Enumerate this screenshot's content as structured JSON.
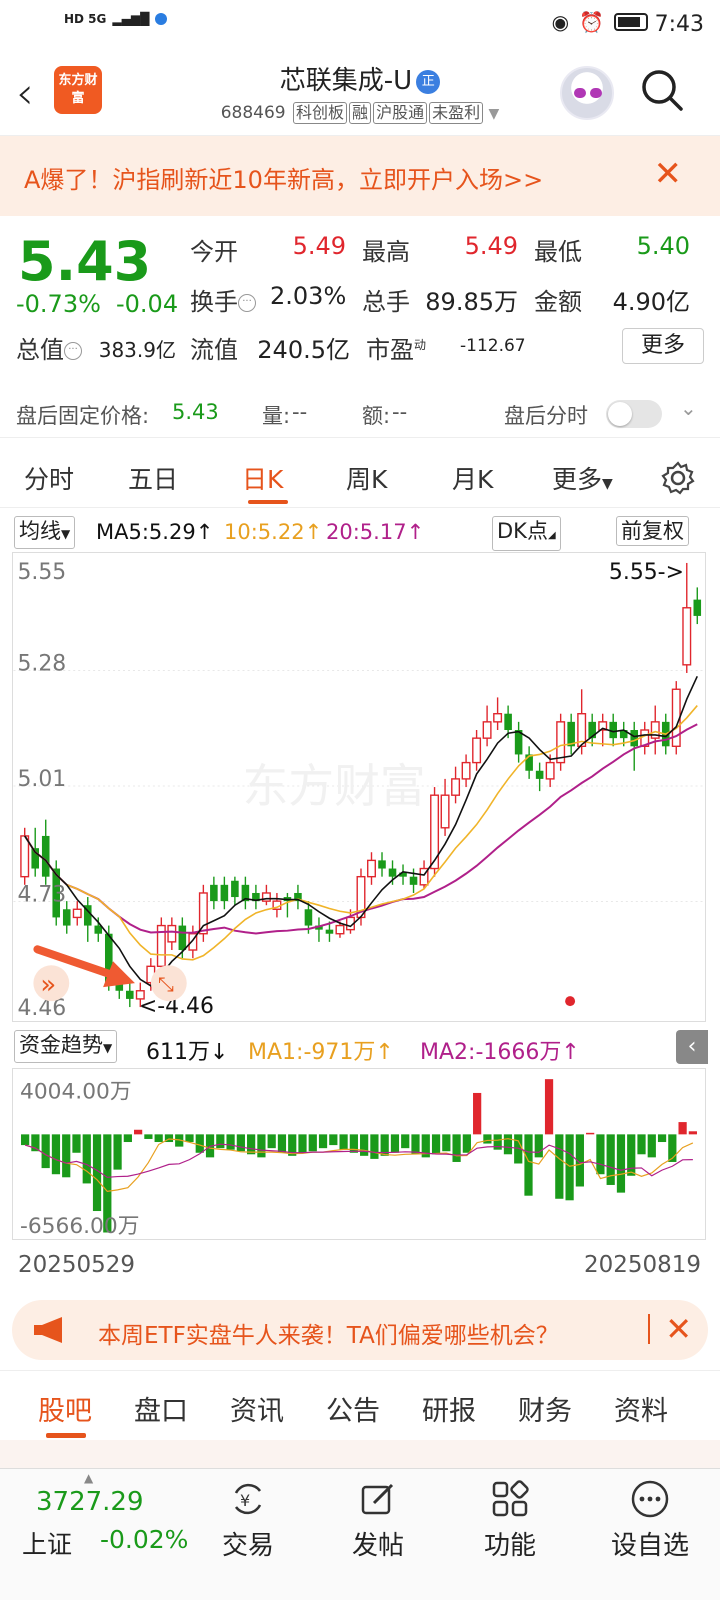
{
  "status_bar": {
    "network": "HD 5G",
    "time": "7:43"
  },
  "header": {
    "logo_text": "东方财富",
    "stock_name": "芯联集成-U",
    "badge": "正",
    "code": "688469",
    "tags": [
      "科创板",
      "融",
      "沪股通",
      "未盈利"
    ]
  },
  "banner": {
    "text": "A爆了！沪指刷新近10年新高，立即开户入场>>",
    "close": "✕"
  },
  "quote": {
    "price": "5.43",
    "change_pct": "-0.73%",
    "change": "-0.04",
    "open_label": "今开",
    "open": "5.49",
    "high_label": "最高",
    "high": "5.49",
    "low_label": "最低",
    "low": "5.40",
    "turnover_label": "换手",
    "turnover": "2.03%",
    "volume_label": "总手",
    "volume": "89.85万",
    "amount_label": "金额",
    "amount": "4.90亿",
    "mktcap_label": "总值",
    "mktcap": "383.9亿",
    "float_label": "流值",
    "float": "240.5亿",
    "pe_label": "市盈",
    "pe_sup": "动",
    "pe": "-112.67",
    "more": "更多"
  },
  "after_hours": {
    "label": "盘后固定价格:",
    "price": "5.43",
    "vol_label": "量:",
    "vol": "--",
    "amt_label": "额:",
    "amt": "--",
    "timeshare": "盘后分时"
  },
  "period_tabs": [
    "分时",
    "五日",
    "日K",
    "周K",
    "月K",
    "更多"
  ],
  "ma": {
    "selector": "均线",
    "ma5": "MA5:5.29",
    "ma10": "10:5.22",
    "ma20": "20:5.17",
    "dk": "DK点",
    "adjust": "前复权"
  },
  "price_axis": {
    "top": "5.55",
    "l2": "5.28",
    "l3": "5.01",
    "l4": "4.73",
    "bottom": "4.46"
  },
  "annotations": {
    "high": "5.55->",
    "low": "<-4.46"
  },
  "fund": {
    "selector": "资金趋势",
    "value": "611万",
    "ma1": "MA1:-971万",
    "ma2": "MA2:-1666万",
    "top": "4004.00万",
    "bottom": "-6566.00万"
  },
  "dates": {
    "start": "20250529",
    "end": "20250819"
  },
  "ad": {
    "text": "本周ETF实盘牛人来袭！TA们偏爱哪些机会？",
    "close": "✕"
  },
  "bottom_tabs": [
    "股吧",
    "盘口",
    "资讯",
    "公告",
    "研报",
    "财务",
    "资料"
  ],
  "nav": {
    "index_value": "3727.29",
    "index_name": "上证",
    "index_change": "-0.02%",
    "items": [
      "交易",
      "发帖",
      "功能",
      "设自选"
    ]
  },
  "colors": {
    "up": "#e0262d",
    "down": "#1a9a1a",
    "accent": "#e6541c",
    "ma5": "#111111",
    "ma10": "#f0b429",
    "ma20": "#b0208a"
  },
  "chart_data": {
    "type": "candlestick",
    "ylim": [
      4.46,
      5.55
    ],
    "candles": [
      {
        "o": 4.78,
        "c": 4.88,
        "h": 4.9,
        "l": 4.76
      },
      {
        "o": 4.85,
        "c": 4.8,
        "h": 4.9,
        "l": 4.78
      },
      {
        "o": 4.88,
        "c": 4.78,
        "h": 4.92,
        "l": 4.76
      },
      {
        "o": 4.8,
        "c": 4.68,
        "h": 4.82,
        "l": 4.66
      },
      {
        "o": 4.7,
        "c": 4.66,
        "h": 4.72,
        "l": 4.64
      },
      {
        "o": 4.68,
        "c": 4.7,
        "h": 4.72,
        "l": 4.66
      },
      {
        "o": 4.71,
        "c": 4.66,
        "h": 4.73,
        "l": 4.62
      },
      {
        "o": 4.66,
        "c": 4.64,
        "h": 4.68,
        "l": 4.62
      },
      {
        "o": 4.64,
        "c": 4.52,
        "h": 4.66,
        "l": 4.5
      },
      {
        "o": 4.54,
        "c": 4.5,
        "h": 4.55,
        "l": 4.48
      },
      {
        "o": 4.5,
        "c": 4.48,
        "h": 4.52,
        "l": 4.46
      },
      {
        "o": 4.48,
        "c": 4.5,
        "h": 4.52,
        "l": 4.46
      },
      {
        "o": 4.52,
        "c": 4.56,
        "h": 4.58,
        "l": 4.5
      },
      {
        "o": 4.56,
        "c": 4.66,
        "h": 4.68,
        "l": 4.54
      },
      {
        "o": 4.62,
        "c": 4.66,
        "h": 4.68,
        "l": 4.6
      },
      {
        "o": 4.66,
        "c": 4.6,
        "h": 4.68,
        "l": 4.58
      },
      {
        "o": 4.6,
        "c": 4.64,
        "h": 4.66,
        "l": 4.58
      },
      {
        "o": 4.64,
        "c": 4.74,
        "h": 4.76,
        "l": 4.62
      },
      {
        "o": 4.76,
        "c": 4.72,
        "h": 4.78,
        "l": 4.7
      },
      {
        "o": 4.76,
        "c": 4.72,
        "h": 4.78,
        "l": 4.7
      },
      {
        "o": 4.77,
        "c": 4.73,
        "h": 4.78,
        "l": 4.71
      },
      {
        "o": 4.76,
        "c": 4.72,
        "h": 4.78,
        "l": 4.7
      },
      {
        "o": 4.74,
        "c": 4.72,
        "h": 4.76,
        "l": 4.7
      },
      {
        "o": 4.72,
        "c": 4.74,
        "h": 4.76,
        "l": 4.71
      },
      {
        "o": 4.7,
        "c": 4.72,
        "h": 4.74,
        "l": 4.68
      },
      {
        "o": 4.73,
        "c": 4.72,
        "h": 4.74,
        "l": 4.68
      },
      {
        "o": 4.74,
        "c": 4.72,
        "h": 4.76,
        "l": 4.7
      },
      {
        "o": 4.7,
        "c": 4.66,
        "h": 4.72,
        "l": 4.64
      },
      {
        "o": 4.66,
        "c": 4.65,
        "h": 4.68,
        "l": 4.62
      },
      {
        "o": 4.65,
        "c": 4.64,
        "h": 4.67,
        "l": 4.62
      },
      {
        "o": 4.64,
        "c": 4.66,
        "h": 4.67,
        "l": 4.63
      },
      {
        "o": 4.65,
        "c": 4.68,
        "h": 4.7,
        "l": 4.64
      },
      {
        "o": 4.68,
        "c": 4.78,
        "h": 4.8,
        "l": 4.66
      },
      {
        "o": 4.78,
        "c": 4.82,
        "h": 4.84,
        "l": 4.76
      },
      {
        "o": 4.82,
        "c": 4.8,
        "h": 4.84,
        "l": 4.78
      },
      {
        "o": 4.8,
        "c": 4.78,
        "h": 4.82,
        "l": 4.76
      },
      {
        "o": 4.79,
        "c": 4.78,
        "h": 4.81,
        "l": 4.76
      },
      {
        "o": 4.78,
        "c": 4.76,
        "h": 4.8,
        "l": 4.74
      },
      {
        "o": 4.76,
        "c": 4.8,
        "h": 4.82,
        "l": 4.75
      },
      {
        "o": 4.8,
        "c": 4.98,
        "h": 5.0,
        "l": 4.78
      },
      {
        "o": 4.9,
        "c": 4.98,
        "h": 5.02,
        "l": 4.88
      },
      {
        "o": 4.98,
        "c": 5.02,
        "h": 5.05,
        "l": 4.96
      },
      {
        "o": 5.02,
        "c": 5.06,
        "h": 5.08,
        "l": 5.0
      },
      {
        "o": 5.06,
        "c": 5.12,
        "h": 5.14,
        "l": 5.04
      },
      {
        "o": 5.12,
        "c": 5.16,
        "h": 5.2,
        "l": 5.1
      },
      {
        "o": 5.16,
        "c": 5.18,
        "h": 5.22,
        "l": 5.14
      },
      {
        "o": 5.18,
        "c": 5.14,
        "h": 5.2,
        "l": 5.12
      },
      {
        "o": 5.14,
        "c": 5.08,
        "h": 5.16,
        "l": 5.06
      },
      {
        "o": 5.08,
        "c": 5.04,
        "h": 5.1,
        "l": 5.02
      },
      {
        "o": 5.04,
        "c": 5.02,
        "h": 5.06,
        "l": 4.99
      },
      {
        "o": 5.02,
        "c": 5.06,
        "h": 5.08,
        "l": 5.0
      },
      {
        "o": 5.06,
        "c": 5.16,
        "h": 5.18,
        "l": 5.04
      },
      {
        "o": 5.16,
        "c": 5.1,
        "h": 5.18,
        "l": 5.08
      },
      {
        "o": 5.1,
        "c": 5.18,
        "h": 5.24,
        "l": 5.08
      },
      {
        "o": 5.16,
        "c": 5.12,
        "h": 5.18,
        "l": 5.1
      },
      {
        "o": 5.14,
        "c": 5.16,
        "h": 5.18,
        "l": 5.1
      },
      {
        "o": 5.16,
        "c": 5.12,
        "h": 5.18,
        "l": 5.1
      },
      {
        "o": 5.14,
        "c": 5.12,
        "h": 5.16,
        "l": 5.1
      },
      {
        "o": 5.14,
        "c": 5.1,
        "h": 5.16,
        "l": 5.04
      },
      {
        "o": 5.1,
        "c": 5.14,
        "h": 5.16,
        "l": 5.08
      },
      {
        "o": 5.12,
        "c": 5.16,
        "h": 5.2,
        "l": 5.08
      },
      {
        "o": 5.16,
        "c": 5.1,
        "h": 5.18,
        "l": 5.08
      },
      {
        "o": 5.1,
        "c": 5.24,
        "h": 5.26,
        "l": 5.08
      },
      {
        "o": 5.3,
        "c": 5.44,
        "h": 5.55,
        "l": 5.28
      },
      {
        "o": 5.46,
        "c": 5.42,
        "h": 5.49,
        "l": 5.4
      }
    ],
    "fund_trend": [
      -700,
      -1100,
      -2200,
      -2600,
      -2800,
      -1200,
      -3200,
      -5000,
      -6400,
      -2300,
      -500,
      300,
      -300,
      -500,
      -500,
      -800,
      -500,
      -1200,
      -1500,
      -900,
      -1000,
      -1100,
      -1300,
      -1500,
      -900,
      -1200,
      -1400,
      -1200,
      -1100,
      -900,
      -700,
      -1000,
      -1200,
      -1400,
      -1600,
      -1400,
      -1200,
      -900,
      -1300,
      -1500,
      -1300,
      -1100,
      -1800,
      -1200,
      2700,
      -600,
      -1000,
      -1300,
      -1900,
      -4000,
      -1500,
      3600,
      -4200,
      -4300,
      -3400,
      100,
      -2600,
      -3300,
      -3800,
      -2700,
      -1300,
      -1500,
      -500,
      -1800,
      800,
      200
    ]
  }
}
